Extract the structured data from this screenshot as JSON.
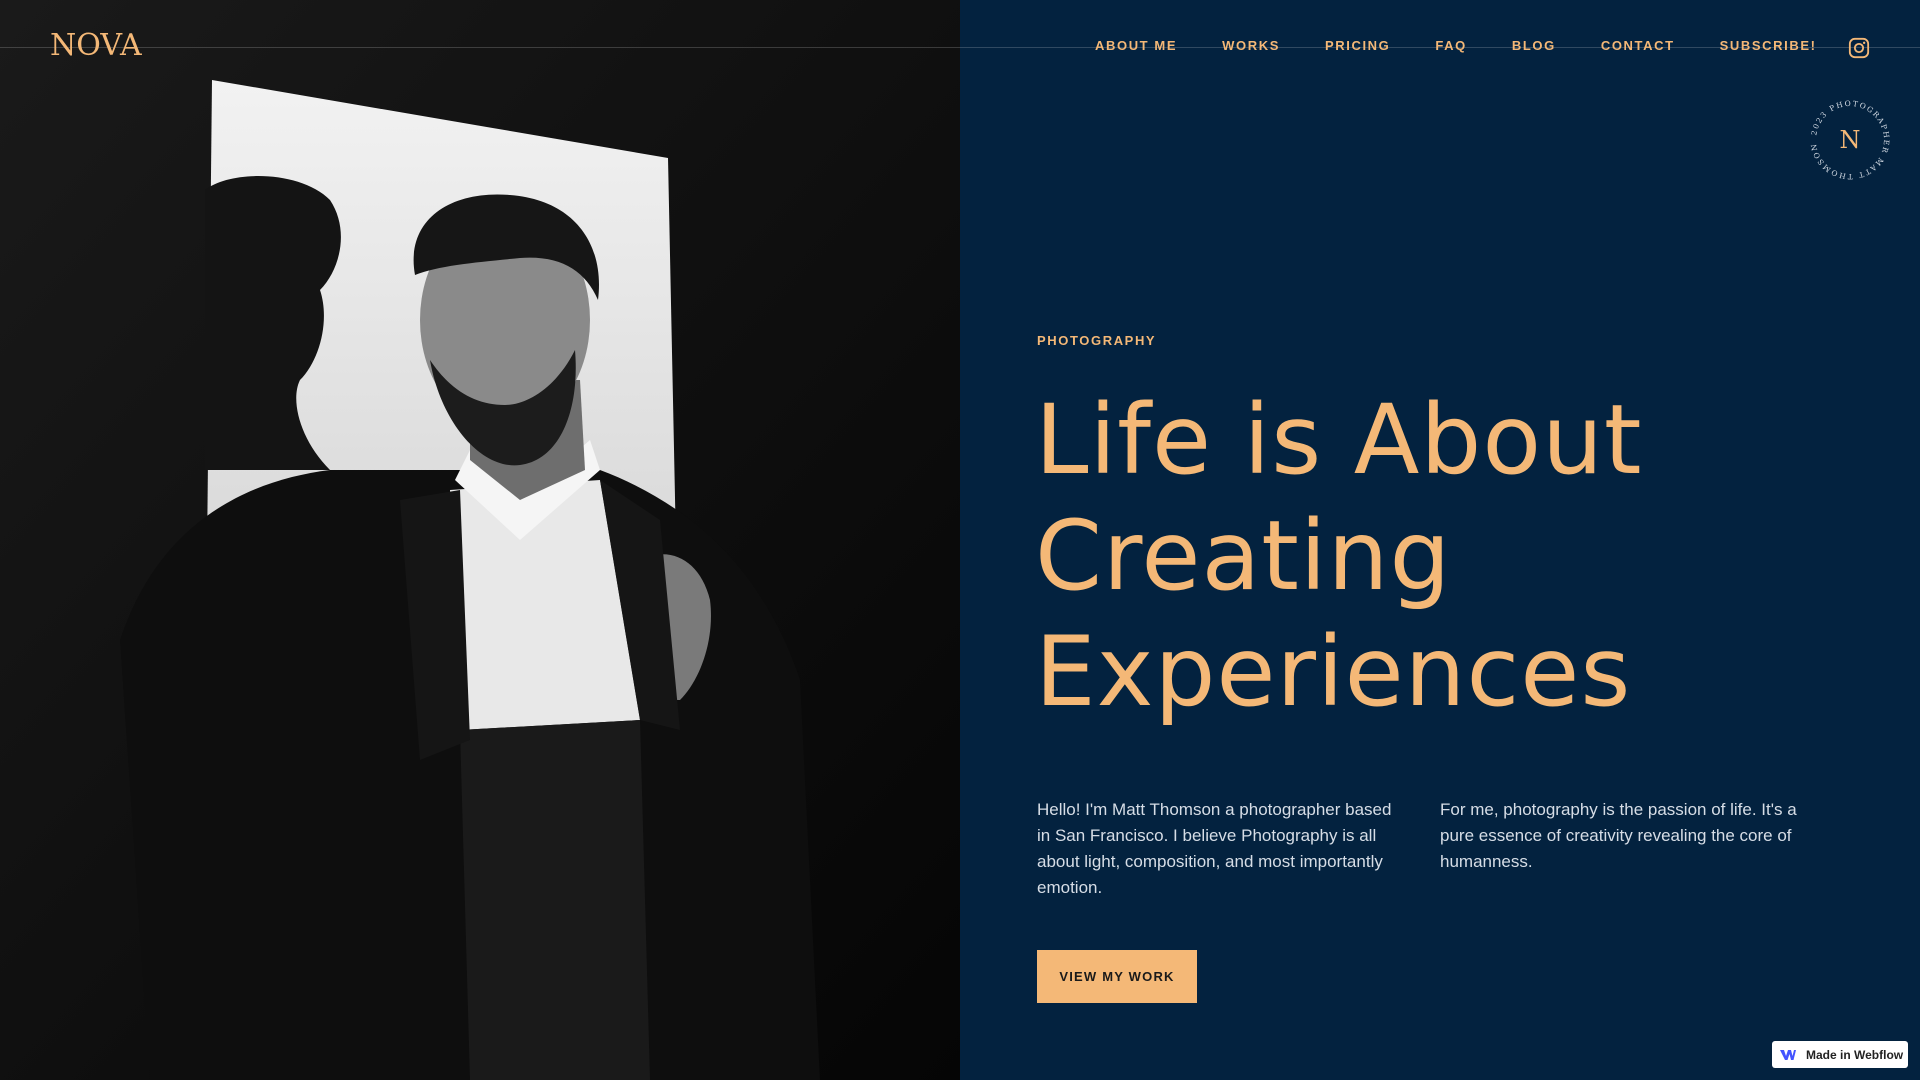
{
  "brand": {
    "logo": "NOVA",
    "accent_color": "#f4b877",
    "background_color": "#03223f"
  },
  "nav": {
    "items": [
      {
        "label": "ABOUT ME"
      },
      {
        "label": "WORKS"
      },
      {
        "label": "PRICING"
      },
      {
        "label": "FAQ"
      },
      {
        "label": "BLOG"
      },
      {
        "label": "CONTACT"
      },
      {
        "label": "SUBSCRIBE!"
      }
    ],
    "social_icon": "instagram-icon"
  },
  "badge": {
    "letter": "N",
    "ring_text": "2023 PHOTOGRAPHER MATT THOMSON"
  },
  "hero": {
    "kicker": "PHOTOGRAPHY",
    "headline_lines": [
      "Life is About",
      "Creating",
      "Experiences"
    ],
    "paragraph_1": "Hello! I'm Matt Thomson a photographer based in San Francisco. I believe Photography is all about light, composition, and most importantly emotion.",
    "paragraph_2": "For me, photography is the passion of life. It's a pure essence of creativity revealing the core of humanness.",
    "cta_label": "VIEW MY WORK"
  },
  "footer_badge": {
    "label": "Made in Webflow",
    "icon": "webflow-icon"
  }
}
